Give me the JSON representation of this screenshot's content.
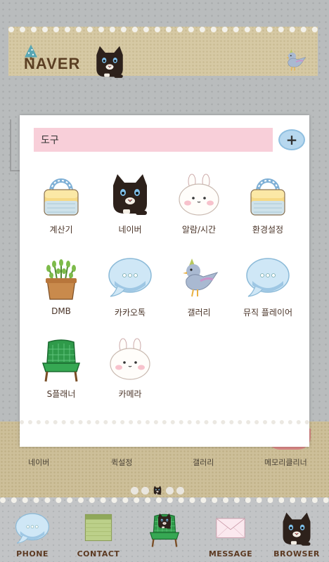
{
  "top_widget": {
    "logo_text": "NAVER"
  },
  "bottom_shortcuts": [
    {
      "label": "네이버"
    },
    {
      "label": "퀵설정"
    },
    {
      "label": "갤러리"
    },
    {
      "label": "메모리클리너"
    }
  ],
  "folder": {
    "name": "도구",
    "add_button_label": "+",
    "apps": [
      {
        "label": "계산기",
        "icon": "basket-icon"
      },
      {
        "label": "네이버",
        "icon": "black-cat-icon"
      },
      {
        "label": "알람/시간",
        "icon": "bunny-icon"
      },
      {
        "label": "환경설정",
        "icon": "basket-icon"
      },
      {
        "label": "DMB",
        "icon": "potted-plant-icon"
      },
      {
        "label": "카카오톡",
        "icon": "speech-bubble-icon"
      },
      {
        "label": "갤러리",
        "icon": "bird-icon"
      },
      {
        "label": "뮤직 플레이어",
        "icon": "speech-bubble-icon"
      },
      {
        "label": "S플래너",
        "icon": "green-chair-icon"
      },
      {
        "label": "카메라",
        "icon": "bunny-icon"
      }
    ]
  },
  "dock": [
    {
      "label": "PHONE",
      "icon": "speech-bubble-icon"
    },
    {
      "label": "CONTACT",
      "icon": "notebook-icon"
    },
    {
      "label": "",
      "icon": "cat-on-chair-icon"
    },
    {
      "label": "MESSAGE",
      "icon": "envelope-icon"
    },
    {
      "label": "BROWSER",
      "icon": "black-cat-icon"
    }
  ],
  "colors": {
    "folder_name_bg": "#f8cfd9",
    "add_button_bg": "#b7d8ef",
    "label_text": "#4a3428",
    "dock_label": "#5c3a22"
  }
}
